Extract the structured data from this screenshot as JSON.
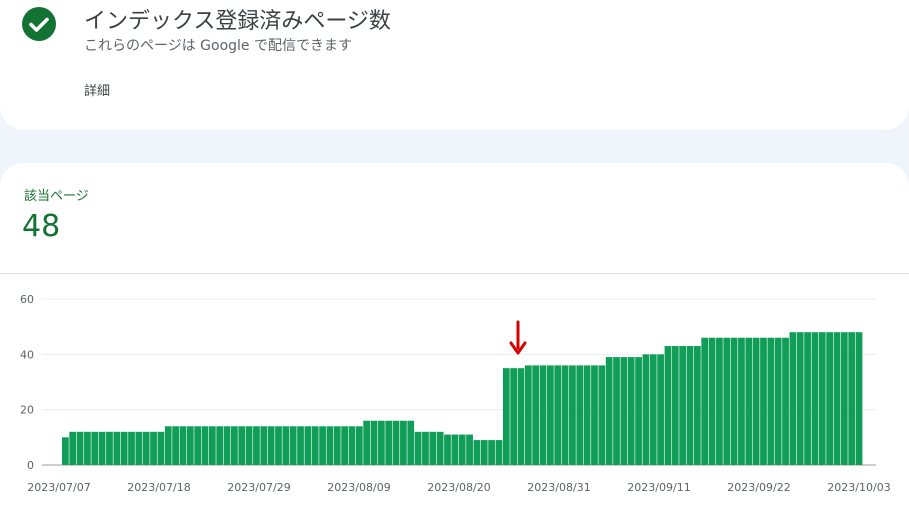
{
  "header": {
    "title": "インデックス登録済みページ数",
    "subtitle": "これらのページは Google で配信できます",
    "detail_label": "詳細",
    "status_icon": "check-circle-icon",
    "accent_color": "#137333"
  },
  "metric": {
    "label": "該当ページ",
    "value": "48"
  },
  "annotation": {
    "icon": "down-arrow-icon",
    "color": "#d50000"
  },
  "chart_data": {
    "type": "bar",
    "bar_color": "#0f9d58",
    "ylim": [
      0,
      60
    ],
    "yticks": [
      0,
      20,
      40,
      60
    ],
    "xtick_labels": [
      "2023/07/07",
      "2023/07/18",
      "2023/07/29",
      "2023/08/09",
      "2023/08/20",
      "2023/08/31",
      "2023/09/11",
      "2023/09/22",
      "2023/10/03"
    ],
    "values": [
      10,
      12,
      12,
      12,
      12,
      12,
      12,
      12,
      12,
      12,
      12,
      12,
      12,
      12,
      14,
      14,
      14,
      14,
      14,
      14,
      14,
      14,
      14,
      14,
      14,
      14,
      14,
      14,
      14,
      14,
      14,
      14,
      14,
      14,
      14,
      14,
      14,
      14,
      14,
      14,
      14,
      16,
      16,
      16,
      16,
      16,
      16,
      16,
      12,
      12,
      12,
      12,
      11,
      11,
      11,
      11,
      9,
      9,
      9,
      9,
      35,
      35,
      35,
      36,
      36,
      36,
      36,
      36,
      36,
      36,
      36,
      36,
      36,
      36,
      39,
      39,
      39,
      39,
      39,
      40,
      40,
      40,
      43,
      43,
      43,
      43,
      43,
      46,
      46,
      46,
      46,
      46,
      46,
      46,
      46,
      46,
      46,
      46,
      46,
      48,
      48,
      48,
      48,
      48,
      48,
      48,
      48,
      48,
      48
    ],
    "grid": true
  }
}
